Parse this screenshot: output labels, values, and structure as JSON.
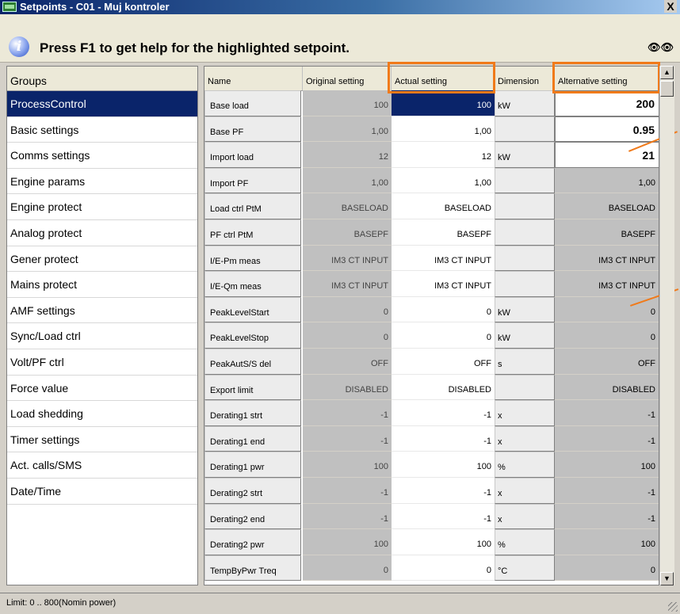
{
  "window": {
    "title": "Setpoints - C01 - Muj kontroler",
    "close_label": "X",
    "help_text": "Press F1 to get help for the highlighted setpoint.",
    "find_icon": "binoculars-icon",
    "info_icon": "info-icon"
  },
  "groups": {
    "header": "Groups",
    "items": [
      {
        "label": "ProcessControl",
        "selected": true
      },
      {
        "label": "Basic settings"
      },
      {
        "label": "Comms settings"
      },
      {
        "label": "Engine params"
      },
      {
        "label": "Engine protect"
      },
      {
        "label": "Analog protect"
      },
      {
        "label": "Gener protect"
      },
      {
        "label": "Mains protect"
      },
      {
        "label": "AMF settings"
      },
      {
        "label": "Sync/Load ctrl"
      },
      {
        "label": "Volt/PF ctrl"
      },
      {
        "label": "Force value"
      },
      {
        "label": "Load shedding"
      },
      {
        "label": "Timer settings"
      },
      {
        "label": "Act. calls/SMS"
      },
      {
        "label": "Date/Time"
      }
    ]
  },
  "table": {
    "columns": [
      "Name",
      "Original setting",
      "Actual setting",
      "Dimension",
      "Alternative setting"
    ],
    "rows": [
      {
        "name": "Base load",
        "original": "100",
        "actual": "100",
        "dimension": "kW",
        "alternative": "200"
      },
      {
        "name": "Base PF",
        "original": "1,00",
        "actual": "1,00",
        "dimension": "",
        "alternative": "0.95"
      },
      {
        "name": "Import load",
        "original": "12",
        "actual": "12",
        "dimension": "kW",
        "alternative": "21"
      },
      {
        "name": "Import PF",
        "original": "1,00",
        "actual": "1,00",
        "dimension": "",
        "alternative": "1,00"
      },
      {
        "name": "Load ctrl PtM",
        "original": "BASELOAD",
        "actual": "BASELOAD",
        "dimension": "",
        "alternative": "BASELOAD"
      },
      {
        "name": "PF ctrl PtM",
        "original": "BASEPF",
        "actual": "BASEPF",
        "dimension": "",
        "alternative": "BASEPF"
      },
      {
        "name": "I/E-Pm meas",
        "original": "IM3 CT INPUT",
        "actual": "IM3 CT INPUT",
        "dimension": "",
        "alternative": "IM3 CT INPUT"
      },
      {
        "name": "I/E-Qm meas",
        "original": "IM3 CT INPUT",
        "actual": "IM3 CT INPUT",
        "dimension": "",
        "alternative": "IM3 CT INPUT"
      },
      {
        "name": "PeakLevelStart",
        "original": "0",
        "actual": "0",
        "dimension": "kW",
        "alternative": "0"
      },
      {
        "name": "PeakLevelStop",
        "original": "0",
        "actual": "0",
        "dimension": "kW",
        "alternative": "0"
      },
      {
        "name": "PeakAutS/S del",
        "original": "OFF",
        "actual": "OFF",
        "dimension": "s",
        "alternative": "OFF"
      },
      {
        "name": "Export limit",
        "original": "DISABLED",
        "actual": "DISABLED",
        "dimension": "",
        "alternative": "DISABLED"
      },
      {
        "name": "Derating1 strt",
        "original": "-1",
        "actual": "-1",
        "dimension": "x",
        "alternative": "-1"
      },
      {
        "name": "Derating1 end",
        "original": "-1",
        "actual": "-1",
        "dimension": "x",
        "alternative": "-1"
      },
      {
        "name": "Derating1 pwr",
        "original": "100",
        "actual": "100",
        "dimension": "%",
        "alternative": "100"
      },
      {
        "name": "Derating2 strt",
        "original": "-1",
        "actual": "-1",
        "dimension": "x",
        "alternative": "-1"
      },
      {
        "name": "Derating2 end",
        "original": "-1",
        "actual": "-1",
        "dimension": "x",
        "alternative": "-1"
      },
      {
        "name": "Derating2 pwr",
        "original": "100",
        "actual": "100",
        "dimension": "%",
        "alternative": "100"
      },
      {
        "name": "TempByPwr Treq",
        "original": "0",
        "actual": "0",
        "dimension": "°C",
        "alternative": "0"
      }
    ]
  },
  "status": {
    "text": "Limit: 0 .. 800(Nomin power)"
  },
  "colors": {
    "highlight": "#f07a1a",
    "selection": "#0a246a"
  }
}
